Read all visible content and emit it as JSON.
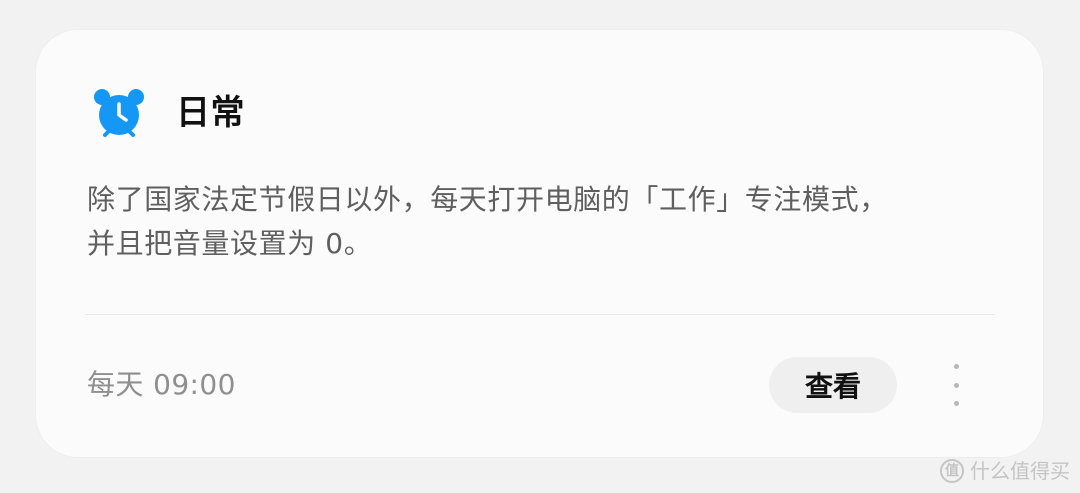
{
  "card": {
    "title": "日常",
    "description_line1": "除了国家法定节假日以外，每天打开电脑的「工作」专注模式，",
    "description_line2": "并且把音量设置为 0。",
    "schedule": "每天 09:00",
    "view_button": "查看",
    "icon_name": "alarm-clock-icon",
    "more_icon_name": "more-vertical-icon"
  },
  "watermark": {
    "text": "什么值得买",
    "icon_text": "值"
  },
  "colors": {
    "accent_blue": "#1597f5",
    "title_text": "#111111",
    "body_text": "#5f5f5f",
    "muted_text": "#8f8f8f",
    "button_bg": "#efefef"
  }
}
